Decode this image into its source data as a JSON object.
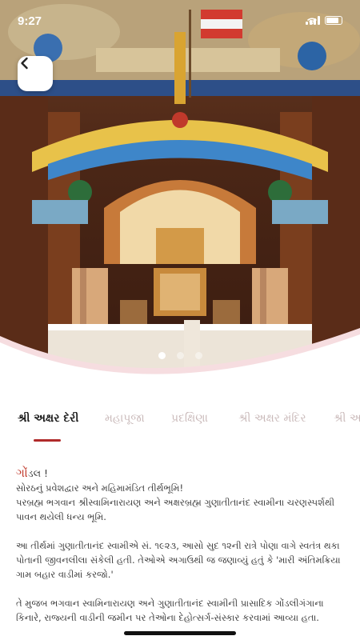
{
  "status": {
    "time": "9:27"
  },
  "hero": {
    "description_icon": "temple-photo",
    "carousel_count": 3,
    "active_index": 0
  },
  "tabs": [
    {
      "label": "શ્રી અક્ષર દેરી",
      "active": true
    },
    {
      "label": "મહાપૂજા",
      "active": false
    },
    {
      "label": "પ્રદક્ષિણા",
      "active": false
    },
    {
      "label": "શ્રી અક્ષર મંદિર",
      "active": false
    },
    {
      "label": "શ્રી અ",
      "active": false
    }
  ],
  "content": {
    "greeting_first": "ગોં",
    "greeting_rest": "ડલ !",
    "lines": [
      "સોરઠનું પ્રવેશદ્વાર અને મહિમામંડિત તીર્થભૂમિ!",
      "પરબ્રહ્મ ભગવાન શ્રીસ્વામિનારાયણ અને અક્ષરબ્રહ્મ ગુણાતીતાનંદ સ્વામીના ચરણસ્પર્શથી",
      "પાવન થયેલી ધન્ય ભૂમિ."
    ],
    "para2": [
      "આ તીર્થમાં ગુણાતીતાનંદ સ્વામીએ સં. ૧૯૨૩, આસો સુદ ૧૨ની રાત્રે પોણા વાગે સ્વતંત્ર થકા",
      "પોતાની જીવનલીલા સંકેલી હતી. તેઓએ અગાઉથી જ જણાવ્યું હતું કે 'મારી અંતિમક્રિયા",
      "ગામ બહાર વાડીમાં કરજો.'"
    ],
    "para3": [
      "તે મુજબ ભગવાન સ્વામિનારાયણ અને ગુણાતીતાનંદ સ્વામીની પ્રાસાદિક ગોંડલીગંગાના",
      "કિનારે, રાજ્યની વાડીની જમીન પર તેઓના દેહોત્સર્ગ-સંસ્કાર કરવામાં આવ્યા હતા."
    ]
  },
  "colors": {
    "accent": "#b02a2a",
    "curve": "#f6dde0"
  }
}
